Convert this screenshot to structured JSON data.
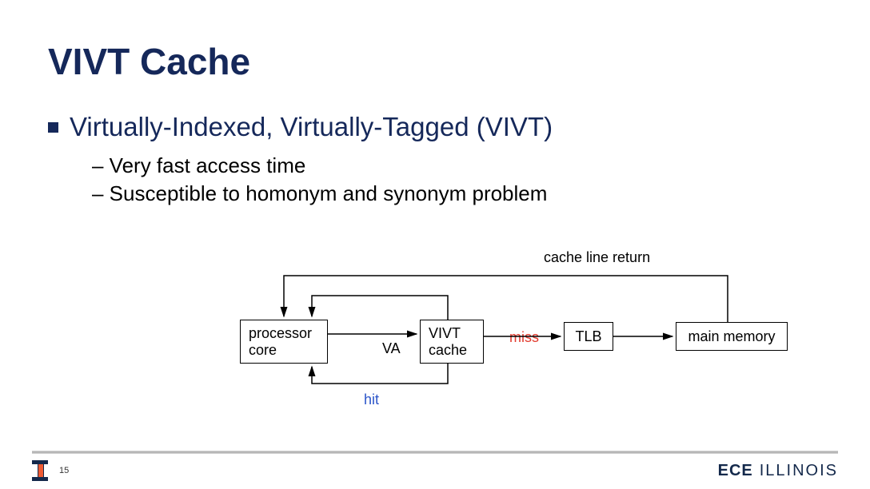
{
  "title": "VIVT Cache",
  "bullet": "Virtually-Indexed, Virtually-Tagged (VIVT)",
  "sub": {
    "item1": "– Very fast access time",
    "item2": "– Susceptible to homonym and synonym problem"
  },
  "diagram": {
    "box_processor_l1": "processor",
    "box_processor_l2": "core",
    "box_vivt_l1": "VIVT",
    "box_vivt_l2": "cache",
    "box_tlb": "TLB",
    "box_mem": "main memory",
    "label_va": "VA",
    "label_miss": "miss",
    "label_hit": "hit",
    "label_cache_line": "cache line return"
  },
  "footer": {
    "page": "15",
    "ece": "ECE",
    "illinois": "ILLINOIS"
  }
}
